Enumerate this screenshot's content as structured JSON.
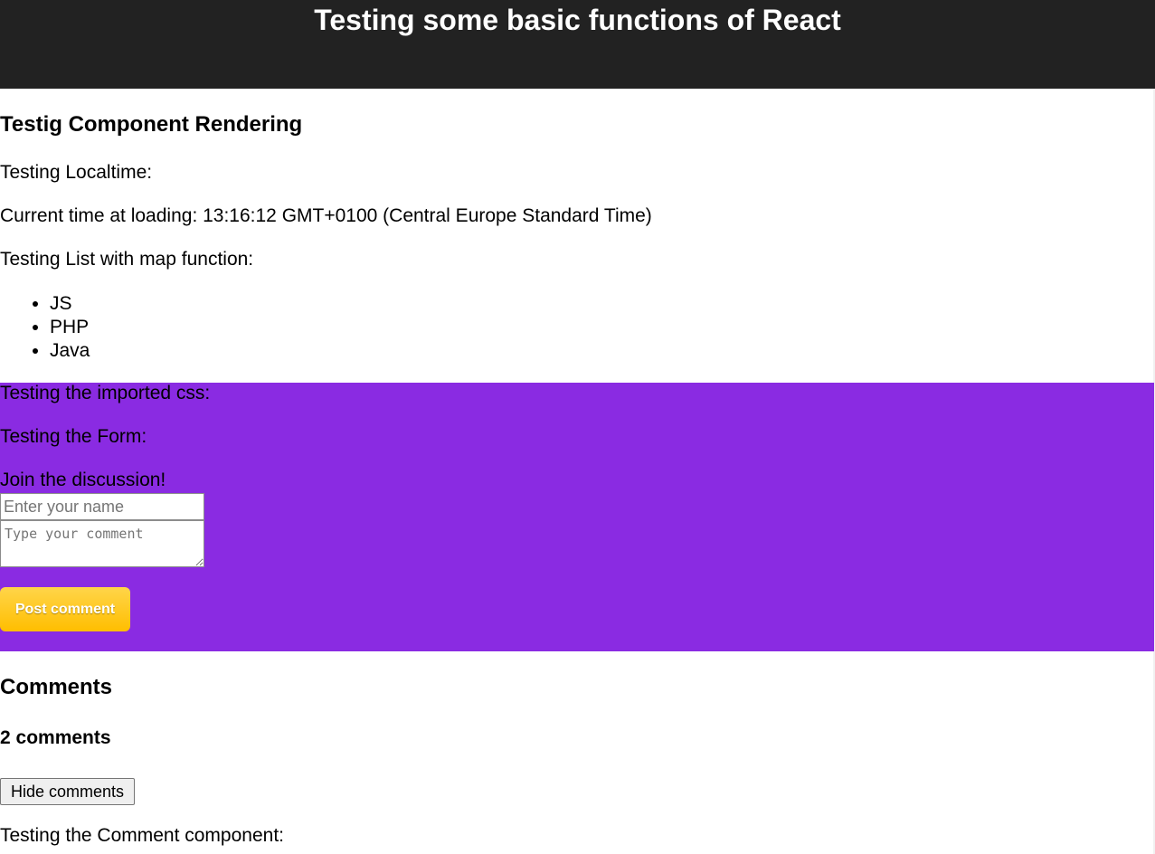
{
  "header": {
    "title": "Testing some basic functions of React"
  },
  "rendering": {
    "heading": "Testig Component Rendering",
    "localtime_label": "Testing Localtime:",
    "current_time": "Current time at loading: 13:16:12 GMT+0100 (Central Europe Standard Time)",
    "list_label": "Testing List with map function:",
    "languages": [
      "JS",
      "PHP",
      "Java"
    ]
  },
  "styled_section": {
    "background_color": "#8a2be2",
    "css_label": "Testing the imported css:",
    "form_label": "Testing the Form:",
    "form": {
      "prompt": "Join the discussion!",
      "name_placeholder": "Enter your name",
      "comment_placeholder": "Type your comment",
      "submit_label": "Post comment",
      "submit_color": "#ffc107"
    }
  },
  "comments": {
    "heading": "Comments",
    "count_text": "2 comments",
    "toggle_label": "Hide comments",
    "component_label": "Testing the Comment component:"
  }
}
